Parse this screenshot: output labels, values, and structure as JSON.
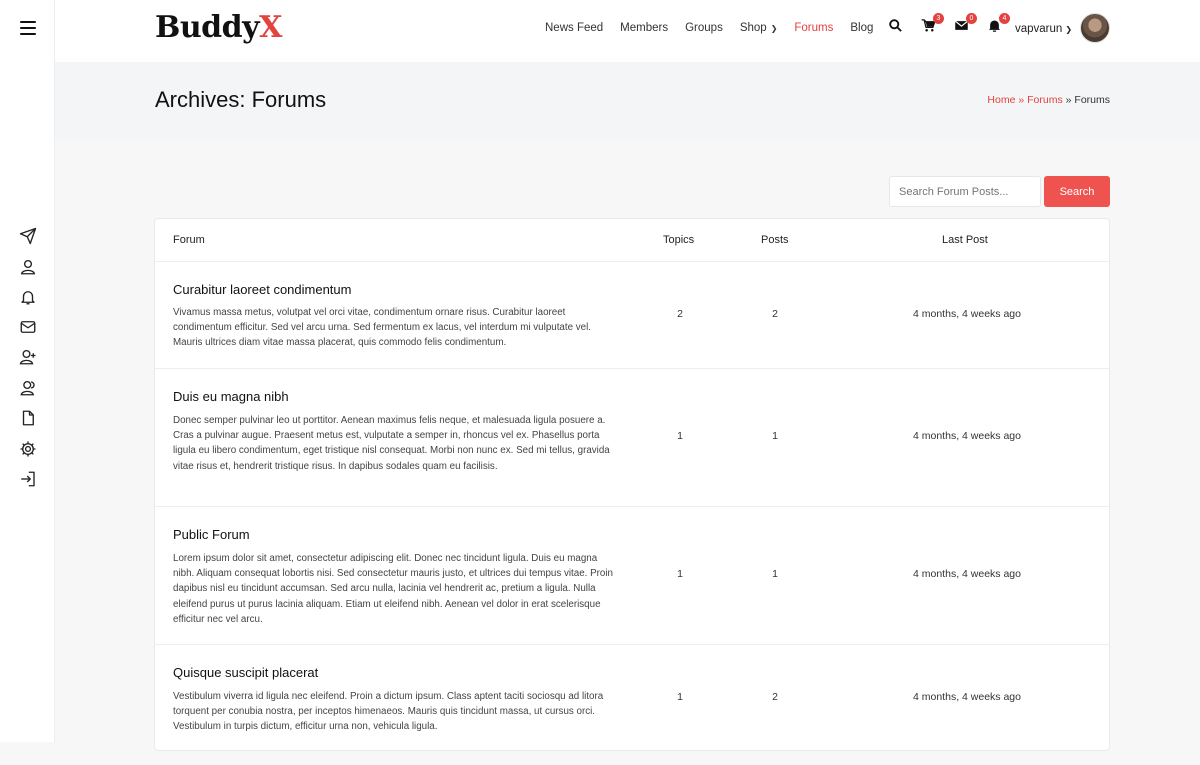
{
  "header": {
    "logo_main": "Buddy",
    "logo_accent": "X",
    "nav": [
      {
        "label": "News Feed",
        "active": false
      },
      {
        "label": "Members",
        "active": false
      },
      {
        "label": "Groups",
        "active": false
      },
      {
        "label": "Shop",
        "active": false,
        "has_dropdown": true
      },
      {
        "label": "Forums",
        "active": true
      },
      {
        "label": "Blog",
        "active": false
      }
    ],
    "icons": [
      {
        "name": "search-icon",
        "badge": ""
      },
      {
        "name": "cart-icon",
        "badge": "3"
      },
      {
        "name": "message-icon",
        "badge": "0"
      },
      {
        "name": "bell-icon",
        "badge": "4"
      }
    ],
    "username": "vapvarun",
    "accent_color": "#e3423f"
  },
  "page": {
    "title": "Archives: Forums",
    "breadcrumb": {
      "home": "Home",
      "sep": "»",
      "forums": "Forums",
      "current": "Forums"
    }
  },
  "search": {
    "placeholder": "Search Forum Posts...",
    "button_label": "Search"
  },
  "table": {
    "columns": {
      "forum": "Forum",
      "topics": "Topics",
      "posts": "Posts",
      "last_post": "Last Post"
    },
    "rows": [
      {
        "title": "Curabitur laoreet condimentum",
        "description": "Vivamus massa metus, volutpat vel orci vitae, condimentum ornare risus. Curabitur laoreet condimentum efficitur. Sed vel arcu urna. Sed fermentum ex lacus, vel interdum mi vulputate vel. Mauris ultrices diam vitae massa placerat, quis commodo felis condimentum.",
        "topics": "2",
        "posts": "2",
        "last_post": "4 months, 4 weeks ago"
      },
      {
        "title": "Duis eu magna nibh",
        "description": "Donec semper pulvinar leo ut porttitor. Aenean maximus felis neque, et malesuada ligula posuere a. Cras a pulvinar augue. Praesent metus est, vulputate a semper in, rhoncus vel ex. Phasellus porta ligula eu libero condimentum, eget tristique nisl consequat. Morbi non nunc ex. Sed mi tellus, gravida vitae risus et, hendrerit tristique risus. In dapibus sodales quam eu facilisis.",
        "topics": "1",
        "posts": "1",
        "last_post": "4 months, 4 weeks ago"
      },
      {
        "title": "Public Forum",
        "description": "Lorem ipsum dolor sit amet, consectetur adipiscing elit. Donec nec tincidunt ligula. Duis eu magna nibh. Aliquam consequat lobortis nisi. Sed consectetur mauris justo, et ultrices dui tempus vitae. Proin dapibus nisl eu tincidunt accumsan. Sed arcu nulla, lacinia vel hendrerit ac, pretium a ligula. Nulla eleifend purus ut purus lacinia aliquam. Etiam ut eleifend nibh. Aenean vel dolor in erat scelerisque efficitur nec vel arcu.",
        "topics": "1",
        "posts": "1",
        "last_post": "4 months, 4 weeks ago"
      },
      {
        "title": "Quisque suscipit placerat",
        "description": "Vestibulum viverra id ligula nec eleifend. Proin a dictum ipsum. Class aptent taciti sociosqu ad litora torquent per conubia nostra, per inceptos himenaeos. Mauris quis tincidunt massa, ut cursus orci. Vestibulum in turpis dictum, efficitur urna non, vehicula ligula.",
        "topics": "1",
        "posts": "2",
        "last_post": "4 months, 4 weeks ago"
      }
    ]
  },
  "sidebar": {
    "icons": [
      "menu-icon",
      "send-icon",
      "user-icon",
      "bell-icon",
      "mail-icon",
      "user-plus-icon",
      "users-icon",
      "file-icon",
      "settings-icon",
      "logout-icon"
    ]
  }
}
